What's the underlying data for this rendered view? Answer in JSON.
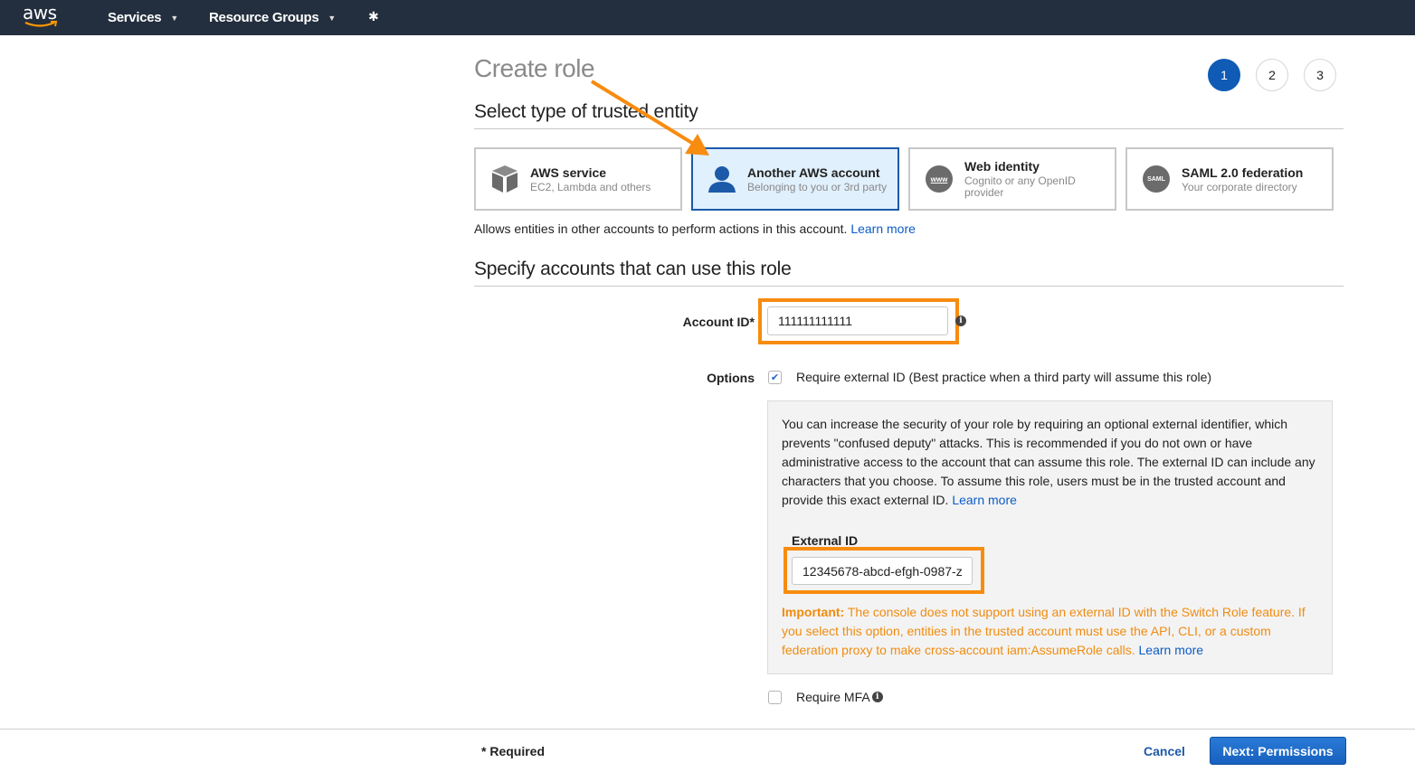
{
  "topbar": {
    "logo_text": "aws",
    "nav": [
      {
        "label": "Services",
        "icon": "chevron-down-icon"
      },
      {
        "label": "Resource Groups",
        "icon": "chevron-down-icon"
      }
    ],
    "pin_icon": "pin-icon"
  },
  "page": {
    "title": "Create role",
    "steps": [
      {
        "label": "1",
        "active": true
      },
      {
        "label": "2",
        "active": false
      },
      {
        "label": "3",
        "active": false
      }
    ]
  },
  "trusted_entity": {
    "heading": "Select type of trusted entity",
    "cards": [
      {
        "title": "AWS service",
        "subtitle": "EC2, Lambda and others",
        "icon": "cube-icon",
        "selected": false
      },
      {
        "title": "Another AWS account",
        "subtitle": "Belonging to you or 3rd party",
        "icon": "user-icon",
        "selected": true
      },
      {
        "title": "Web identity",
        "subtitle": "Cognito or any OpenID provider",
        "icon": "www-icon",
        "icon_text": "www",
        "selected": false
      },
      {
        "title": "SAML 2.0 federation",
        "subtitle": "Your corporate directory",
        "icon": "saml-icon",
        "icon_text": "SAML",
        "selected": false
      }
    ],
    "description": "Allows entities in other accounts to perform actions in this account.",
    "learn_more": "Learn more"
  },
  "accounts": {
    "heading": "Specify accounts that can use this role",
    "account_id_label": "Account ID*",
    "account_id_value": "111111111111",
    "options_label": "Options",
    "require_external_id": {
      "label": "Require external ID (Best practice when a third party will assume this role)",
      "checked": true
    },
    "external_panel": {
      "text": "You can increase the security of your role by requiring an optional external identifier, which prevents \"confused deputy\" attacks. This is recommended if you do not own or have administrative access to the account that can assume this role. The external ID can include any characters that you choose. To assume this role, users must be in the trusted account and provide this exact external ID.",
      "learn_more": "Learn more",
      "external_id_label": "External ID",
      "external_id_value": "12345678-abcd-efgh-0987-z",
      "important_label": "Important:",
      "important_text": "The console does not support using an external ID with the Switch Role feature. If you select this option, entities in the trusted account must use the API, CLI, or a custom federation proxy to make cross-account iam:AssumeRole calls.",
      "important_learn_more": "Learn more"
    },
    "require_mfa": {
      "label": "Require MFA",
      "checked": false
    }
  },
  "footer": {
    "required_note": "* Required",
    "cancel_label": "Cancel",
    "next_label": "Next: Permissions"
  },
  "colors": {
    "topbar": "#232f3e",
    "primary": "#1c5aa9",
    "highlight": "#f78c10",
    "warning": "#f08c10",
    "selected_card_bg": "#e1f0fd"
  }
}
